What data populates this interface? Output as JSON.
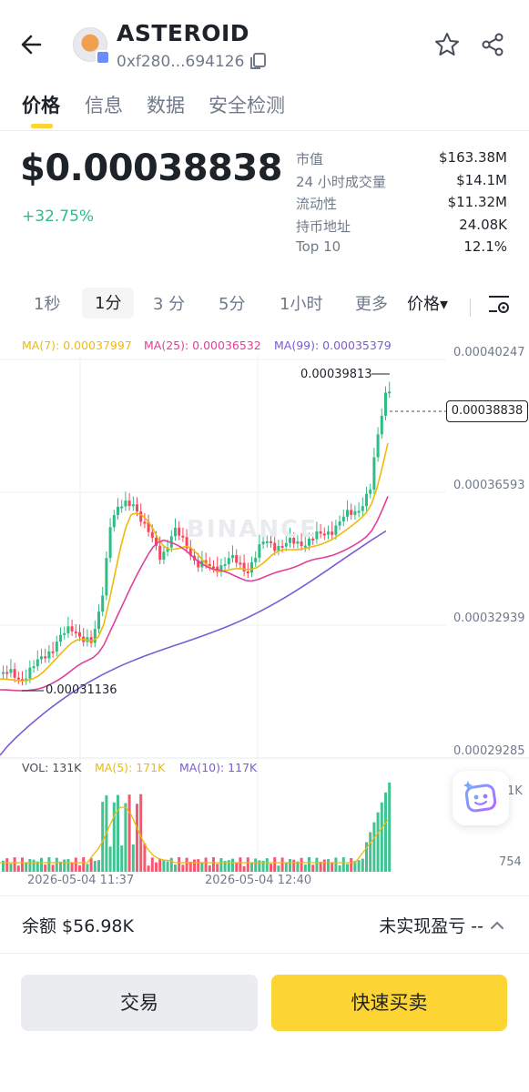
{
  "header": {
    "token_name": "ASTEROID",
    "token_address": "0xf280...694126"
  },
  "tabs": [
    "价格",
    "信息",
    "数据",
    "安全检测"
  ],
  "price": {
    "value": "$0.00038838",
    "change": "+32.75%"
  },
  "stats": [
    {
      "label": "市值",
      "value": "$163.38M"
    },
    {
      "label": "24 小时成交量",
      "value": "$14.1M"
    },
    {
      "label": "流动性",
      "value": "$11.32M"
    },
    {
      "label": "持币地址",
      "value": "24.08K"
    },
    {
      "label": "Top 10",
      "value": "12.1%"
    }
  ],
  "intervals": {
    "items": [
      "1秒",
      "1分",
      "3 分",
      "5分",
      "1小时",
      "更多"
    ],
    "active": "1分",
    "price_type": "价格▾"
  },
  "chart": {
    "ma7": "MA(7): 0.00037997",
    "ma25": "MA(25): 0.00036532",
    "ma99": "MA(99): 0.00035379",
    "y_ticks": [
      "0.00040247",
      "0.00036593",
      "0.00032939",
      "0.00029285"
    ],
    "current_price": "0.00038838",
    "high": "0.00039813",
    "low": "0.00031136",
    "watermark": "BINANCE",
    "vol": "VOL: 131K",
    "vol_ma5": "MA(5): 171K",
    "vol_ma10": "MA(10): 117K",
    "vol_ticks": [
      "1K",
      "754"
    ],
    "times": [
      "2026-05-04 11:37",
      "2026-05-04 12:40"
    ],
    "colors": {
      "up": "#2ebd85",
      "down": "#f6465d",
      "ma7": "#f0b90b",
      "ma25": "#e0409a",
      "ma99": "#7b5bd6"
    }
  },
  "balance": {
    "label": "余额 $56.98K",
    "pnl": "未实现盈亏 --"
  },
  "buttons": {
    "trade": "交易",
    "quick": "快速买卖"
  }
}
